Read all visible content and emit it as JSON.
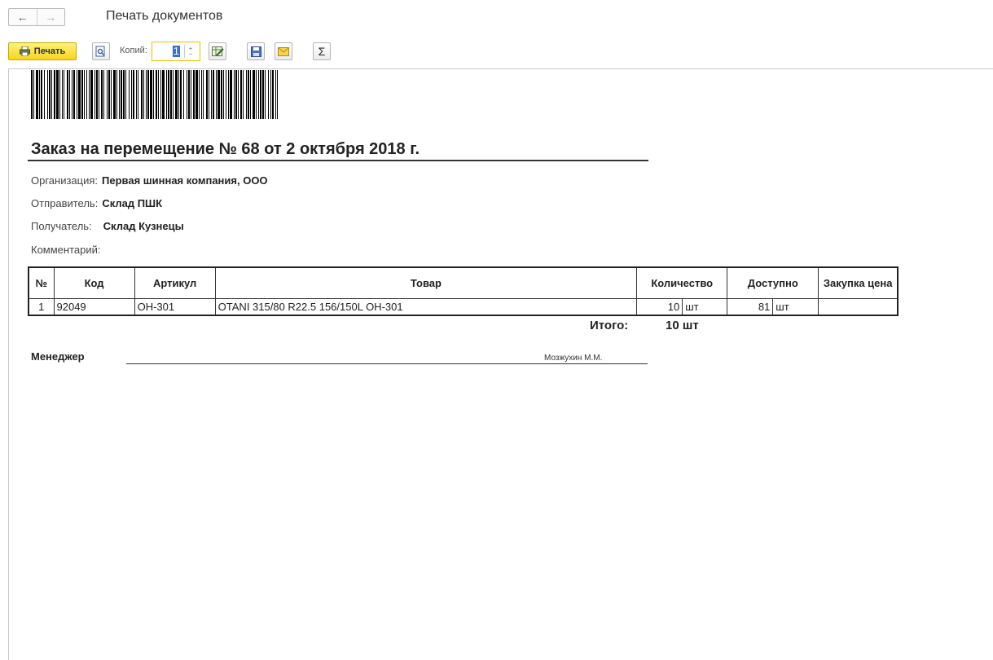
{
  "window": {
    "title": "Печать документов"
  },
  "nav": {
    "back": "←",
    "forward": "→"
  },
  "toolbar": {
    "print_label": "Печать",
    "copies_label": "Копий:",
    "copies_value": "1",
    "sigma": "Σ"
  },
  "document": {
    "title": "Заказ на перемещение № 68 от 2 октября 2018 г.",
    "organization_label": "Организация:",
    "organization_value": "Первая шинная компания, ООО",
    "sender_label": "Отправитель:",
    "sender_value": "Склад ПШК",
    "receiver_label": "Получатель:",
    "receiver_value": "Склад Кузнецы",
    "comment_label": "Комментарий:",
    "table": {
      "headers": {
        "num": "№",
        "code": "Код",
        "article": "Артикул",
        "product": "Товар",
        "quantity": "Количество",
        "available": "Доступно",
        "purchase_price": "Закупка цена"
      },
      "rows": [
        {
          "num": "1",
          "code": "92049",
          "article": "OH-301",
          "product": "OTANI 315/80 R22.5 156/150L OH-301",
          "quantity": "10",
          "quantity_unit": "шт",
          "available": "81",
          "available_unit": "шт",
          "purchase_price": ""
        }
      ]
    },
    "total_label": "Итого:",
    "total_value": "10  шт",
    "manager_label": "Менеджер",
    "manager_name": "Мозжухин М.М."
  }
}
